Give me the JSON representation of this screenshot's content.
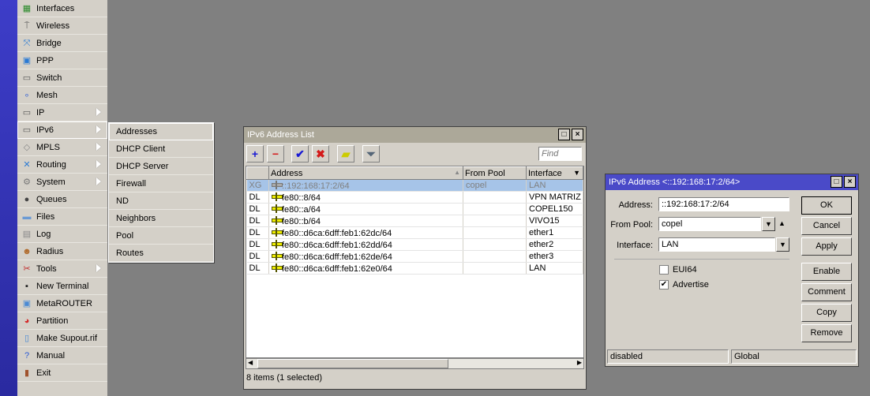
{
  "sidebar": {
    "items": [
      {
        "label": "Interfaces",
        "icon": "interfaces-icon",
        "glyph": "▦",
        "color": "#2a8a2a"
      },
      {
        "label": "Wireless",
        "icon": "wireless-icon",
        "glyph": "⍑",
        "color": "#555"
      },
      {
        "label": "Bridge",
        "icon": "bridge-icon",
        "glyph": "⤧",
        "color": "#2a7ad4"
      },
      {
        "label": "PPP",
        "icon": "ppp-icon",
        "glyph": "▣",
        "color": "#2a7ad4"
      },
      {
        "label": "Switch",
        "icon": "switch-icon",
        "glyph": "▭",
        "color": "#555"
      },
      {
        "label": "Mesh",
        "icon": "mesh-icon",
        "glyph": "∘",
        "color": "#2a5ad4"
      },
      {
        "label": "IP",
        "icon": "ip-icon",
        "glyph": "▭",
        "color": "#555",
        "submenu": true
      },
      {
        "label": "IPv6",
        "icon": "ipv6-icon",
        "glyph": "▭",
        "color": "#555",
        "submenu": true,
        "selected": true
      },
      {
        "label": "MPLS",
        "icon": "mpls-icon",
        "glyph": "◇",
        "color": "#888",
        "submenu": true
      },
      {
        "label": "Routing",
        "icon": "routing-icon",
        "glyph": "✕",
        "color": "#2a7ad4",
        "submenu": true
      },
      {
        "label": "System",
        "icon": "system-icon",
        "glyph": "⚙",
        "color": "#777",
        "submenu": true
      },
      {
        "label": "Queues",
        "icon": "queues-icon",
        "glyph": "●",
        "color": "#444"
      },
      {
        "label": "Files",
        "icon": "files-icon",
        "glyph": "▬",
        "color": "#6a9ad4"
      },
      {
        "label": "Log",
        "icon": "log-icon",
        "glyph": "▤",
        "color": "#888"
      },
      {
        "label": "Radius",
        "icon": "radius-icon",
        "glyph": "☻",
        "color": "#b06a2a"
      },
      {
        "label": "Tools",
        "icon": "tools-icon",
        "glyph": "✂",
        "color": "#c02a2a",
        "submenu": true
      },
      {
        "label": "New Terminal",
        "icon": "terminal-icon",
        "glyph": "▪",
        "color": "#222"
      },
      {
        "label": "MetaROUTER",
        "icon": "metarouter-icon",
        "glyph": "▣",
        "color": "#4a8ad4"
      },
      {
        "label": "Partition",
        "icon": "partition-icon",
        "glyph": "◕",
        "color": "#d42a2a"
      },
      {
        "label": "Make Supout.rif",
        "icon": "supout-icon",
        "glyph": "▯",
        "color": "#4a8ad4"
      },
      {
        "label": "Manual",
        "icon": "manual-icon",
        "glyph": "?",
        "color": "#2a5ad4"
      },
      {
        "label": "Exit",
        "icon": "exit-icon",
        "glyph": "▮",
        "color": "#a0522d"
      }
    ]
  },
  "submenu": {
    "items": [
      "Addresses",
      "DHCP Client",
      "DHCP Server",
      "Firewall",
      "ND",
      "Neighbors",
      "Pool",
      "Routes"
    ]
  },
  "list_window": {
    "title": "IPv6 Address List",
    "find_placeholder": "Find",
    "columns": [
      "",
      "Address",
      "From Pool",
      "Interface"
    ],
    "rows": [
      {
        "flags": "XG",
        "address": "::192:168:17:2/64",
        "pool": "copel",
        "interface": "LAN",
        "selected": true
      },
      {
        "flags": "DL",
        "address": "fe80::8/64",
        "pool": "",
        "interface": "VPN MATRIZ"
      },
      {
        "flags": "DL",
        "address": "fe80::a/64",
        "pool": "",
        "interface": "COPEL150"
      },
      {
        "flags": "DL",
        "address": "fe80::b/64",
        "pool": "",
        "interface": "VIVO15"
      },
      {
        "flags": "DL",
        "address": "fe80::d6ca:6dff:feb1:62dc/64",
        "pool": "",
        "interface": "ether1"
      },
      {
        "flags": "DL",
        "address": "fe80::d6ca:6dff:feb1:62dd/64",
        "pool": "",
        "interface": "ether2"
      },
      {
        "flags": "DL",
        "address": "fe80::d6ca:6dff:feb1:62de/64",
        "pool": "",
        "interface": "ether3"
      },
      {
        "flags": "DL",
        "address": "fe80::d6ca:6dff:feb1:62e0/64",
        "pool": "",
        "interface": "LAN"
      }
    ],
    "status": "8 items (1 selected)"
  },
  "dialog": {
    "title": "IPv6 Address <::192:168:17:2/64>",
    "address_label": "Address:",
    "address": "::192:168:17:2/64",
    "pool_label": "From Pool:",
    "pool": "copel",
    "interface_label": "Interface:",
    "interface": "LAN",
    "eui64_label": "EUI64",
    "eui64": false,
    "advertise_label": "Advertise",
    "advertise": true,
    "buttons": [
      "OK",
      "Cancel",
      "Apply",
      "Enable",
      "Comment",
      "Copy",
      "Remove"
    ],
    "status_left": "disabled",
    "status_right": "Global"
  },
  "colors": {
    "active_title": "#4a4ac8",
    "inactive_title": "#aca899",
    "selection": "#a6c4e8"
  }
}
